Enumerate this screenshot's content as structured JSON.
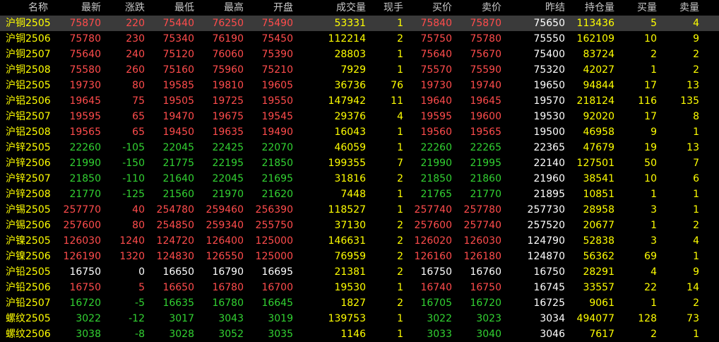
{
  "colors": {
    "up": "#ff4c4c",
    "down": "#32d232",
    "flat": "#ffffff",
    "name": "#ffff00",
    "volume": "#ffff00",
    "header": "#c8c8c8",
    "selected_row": "#3a3a3a",
    "background": "#000000"
  },
  "columns": {
    "name": "名称",
    "last": "最新",
    "change": "涨跌",
    "low": "最低",
    "high": "最高",
    "open": "开盘",
    "volume": "成交量",
    "current_hand": "现手",
    "bid": "买价",
    "ask": "卖价",
    "prev_settle": "昨结",
    "open_interest": "持仓量",
    "bid_volume": "买量",
    "ask_volume": "卖量"
  },
  "rows": [
    {
      "name": "沪铜2505",
      "last": "75870",
      "change": "220",
      "low": "75440",
      "high": "76250",
      "open": "75490",
      "volume": "53331",
      "current_hand": "1",
      "bid": "75840",
      "ask": "75870",
      "prev_settle": "75650",
      "open_interest": "113436",
      "bid_volume": "5",
      "ask_volume": "4",
      "trend": "up",
      "selected": true
    },
    {
      "name": "沪铜2506",
      "last": "75780",
      "change": "230",
      "low": "75340",
      "high": "76190",
      "open": "75450",
      "volume": "112214",
      "current_hand": "2",
      "bid": "75750",
      "ask": "75780",
      "prev_settle": "75550",
      "open_interest": "162109",
      "bid_volume": "10",
      "ask_volume": "9",
      "trend": "up"
    },
    {
      "name": "沪铜2507",
      "last": "75640",
      "change": "240",
      "low": "75120",
      "high": "76060",
      "open": "75390",
      "volume": "28803",
      "current_hand": "1",
      "bid": "75640",
      "ask": "75670",
      "prev_settle": "75400",
      "open_interest": "83724",
      "bid_volume": "2",
      "ask_volume": "2",
      "trend": "up"
    },
    {
      "name": "沪铜2508",
      "last": "75580",
      "change": "260",
      "low": "75160",
      "high": "75960",
      "open": "75210",
      "volume": "7929",
      "current_hand": "1",
      "bid": "75570",
      "ask": "75590",
      "prev_settle": "75320",
      "open_interest": "42027",
      "bid_volume": "1",
      "ask_volume": "2",
      "trend": "up"
    },
    {
      "name": "沪铝2505",
      "last": "19730",
      "change": "80",
      "low": "19585",
      "high": "19810",
      "open": "19605",
      "volume": "36736",
      "current_hand": "76",
      "bid": "19730",
      "ask": "19740",
      "prev_settle": "19650",
      "open_interest": "94844",
      "bid_volume": "17",
      "ask_volume": "13",
      "trend": "up"
    },
    {
      "name": "沪铝2506",
      "last": "19645",
      "change": "75",
      "low": "19505",
      "high": "19725",
      "open": "19550",
      "volume": "147942",
      "current_hand": "11",
      "bid": "19640",
      "ask": "19645",
      "prev_settle": "19570",
      "open_interest": "218124",
      "bid_volume": "116",
      "ask_volume": "135",
      "trend": "up"
    },
    {
      "name": "沪铝2507",
      "last": "19595",
      "change": "65",
      "low": "19470",
      "high": "19675",
      "open": "19545",
      "volume": "29376",
      "current_hand": "4",
      "bid": "19595",
      "ask": "19600",
      "prev_settle": "19530",
      "open_interest": "92020",
      "bid_volume": "17",
      "ask_volume": "8",
      "trend": "up"
    },
    {
      "name": "沪铝2508",
      "last": "19565",
      "change": "65",
      "low": "19450",
      "high": "19635",
      "open": "19490",
      "volume": "16043",
      "current_hand": "1",
      "bid": "19560",
      "ask": "19565",
      "prev_settle": "19500",
      "open_interest": "46958",
      "bid_volume": "9",
      "ask_volume": "1",
      "trend": "up"
    },
    {
      "name": "沪锌2505",
      "last": "22260",
      "change": "-105",
      "low": "22045",
      "high": "22425",
      "open": "22070",
      "volume": "46059",
      "current_hand": "1",
      "bid": "22260",
      "ask": "22265",
      "prev_settle": "22365",
      "open_interest": "47679",
      "bid_volume": "19",
      "ask_volume": "13",
      "trend": "down"
    },
    {
      "name": "沪锌2506",
      "last": "21990",
      "change": "-150",
      "low": "21775",
      "high": "22195",
      "open": "21850",
      "volume": "199355",
      "current_hand": "7",
      "bid": "21990",
      "ask": "21995",
      "prev_settle": "22140",
      "open_interest": "127501",
      "bid_volume": "50",
      "ask_volume": "7",
      "trend": "down"
    },
    {
      "name": "沪锌2507",
      "last": "21850",
      "change": "-110",
      "low": "21640",
      "high": "22045",
      "open": "21695",
      "volume": "31816",
      "current_hand": "2",
      "bid": "21850",
      "ask": "21860",
      "prev_settle": "21960",
      "open_interest": "38541",
      "bid_volume": "10",
      "ask_volume": "6",
      "trend": "down"
    },
    {
      "name": "沪锌2508",
      "last": "21770",
      "change": "-125",
      "low": "21560",
      "high": "21970",
      "open": "21620",
      "volume": "7448",
      "current_hand": "1",
      "bid": "21765",
      "ask": "21770",
      "prev_settle": "21895",
      "open_interest": "10851",
      "bid_volume": "1",
      "ask_volume": "1",
      "trend": "down"
    },
    {
      "name": "沪锡2505",
      "last": "257770",
      "change": "40",
      "low": "254780",
      "high": "259460",
      "open": "256390",
      "volume": "118527",
      "current_hand": "1",
      "bid": "257740",
      "ask": "257780",
      "prev_settle": "257730",
      "open_interest": "28958",
      "bid_volume": "3",
      "ask_volume": "1",
      "trend": "up"
    },
    {
      "name": "沪锡2506",
      "last": "257600",
      "change": "80",
      "low": "254850",
      "high": "259340",
      "open": "255750",
      "volume": "37130",
      "current_hand": "2",
      "bid": "257600",
      "ask": "257740",
      "prev_settle": "257520",
      "open_interest": "20677",
      "bid_volume": "1",
      "ask_volume": "2",
      "trend": "up"
    },
    {
      "name": "沪镍2505",
      "last": "126030",
      "change": "1240",
      "low": "124720",
      "high": "126400",
      "open": "125000",
      "volume": "146631",
      "current_hand": "2",
      "bid": "126020",
      "ask": "126030",
      "prev_settle": "124790",
      "open_interest": "52838",
      "bid_volume": "3",
      "ask_volume": "4",
      "trend": "up"
    },
    {
      "name": "沪镍2506",
      "last": "126190",
      "change": "1320",
      "low": "124830",
      "high": "126550",
      "open": "125000",
      "volume": "76959",
      "current_hand": "2",
      "bid": "126160",
      "ask": "126180",
      "prev_settle": "124870",
      "open_interest": "56362",
      "bid_volume": "69",
      "ask_volume": "1",
      "trend": "up"
    },
    {
      "name": "沪铅2505",
      "last": "16750",
      "change": "0",
      "low": "16650",
      "high": "16790",
      "open": "16695",
      "volume": "21381",
      "current_hand": "2",
      "bid": "16750",
      "ask": "16760",
      "prev_settle": "16750",
      "open_interest": "28291",
      "bid_volume": "4",
      "ask_volume": "9",
      "trend": "flat"
    },
    {
      "name": "沪铅2506",
      "last": "16750",
      "change": "5",
      "low": "16650",
      "high": "16780",
      "open": "16700",
      "volume": "19530",
      "current_hand": "1",
      "bid": "16740",
      "ask": "16750",
      "prev_settle": "16745",
      "open_interest": "33557",
      "bid_volume": "22",
      "ask_volume": "14",
      "trend": "up"
    },
    {
      "name": "沪铅2507",
      "last": "16720",
      "change": "-5",
      "low": "16635",
      "high": "16780",
      "open": "16645",
      "volume": "1827",
      "current_hand": "2",
      "bid": "16705",
      "ask": "16720",
      "prev_settle": "16725",
      "open_interest": "9061",
      "bid_volume": "1",
      "ask_volume": "2",
      "trend": "down"
    },
    {
      "name": "螺纹2505",
      "last": "3022",
      "change": "-12",
      "low": "3017",
      "high": "3043",
      "open": "3019",
      "volume": "139753",
      "current_hand": "1",
      "bid": "3022",
      "ask": "3023",
      "prev_settle": "3034",
      "open_interest": "494077",
      "bid_volume": "128",
      "ask_volume": "73",
      "trend": "down"
    },
    {
      "name": "螺纹2506",
      "last": "3038",
      "change": "-8",
      "low": "3028",
      "high": "3052",
      "open": "3035",
      "volume": "1146",
      "current_hand": "1",
      "bid": "3033",
      "ask": "3040",
      "prev_settle": "3046",
      "open_interest": "7617",
      "bid_volume": "2",
      "ask_volume": "1",
      "trend": "down"
    }
  ]
}
